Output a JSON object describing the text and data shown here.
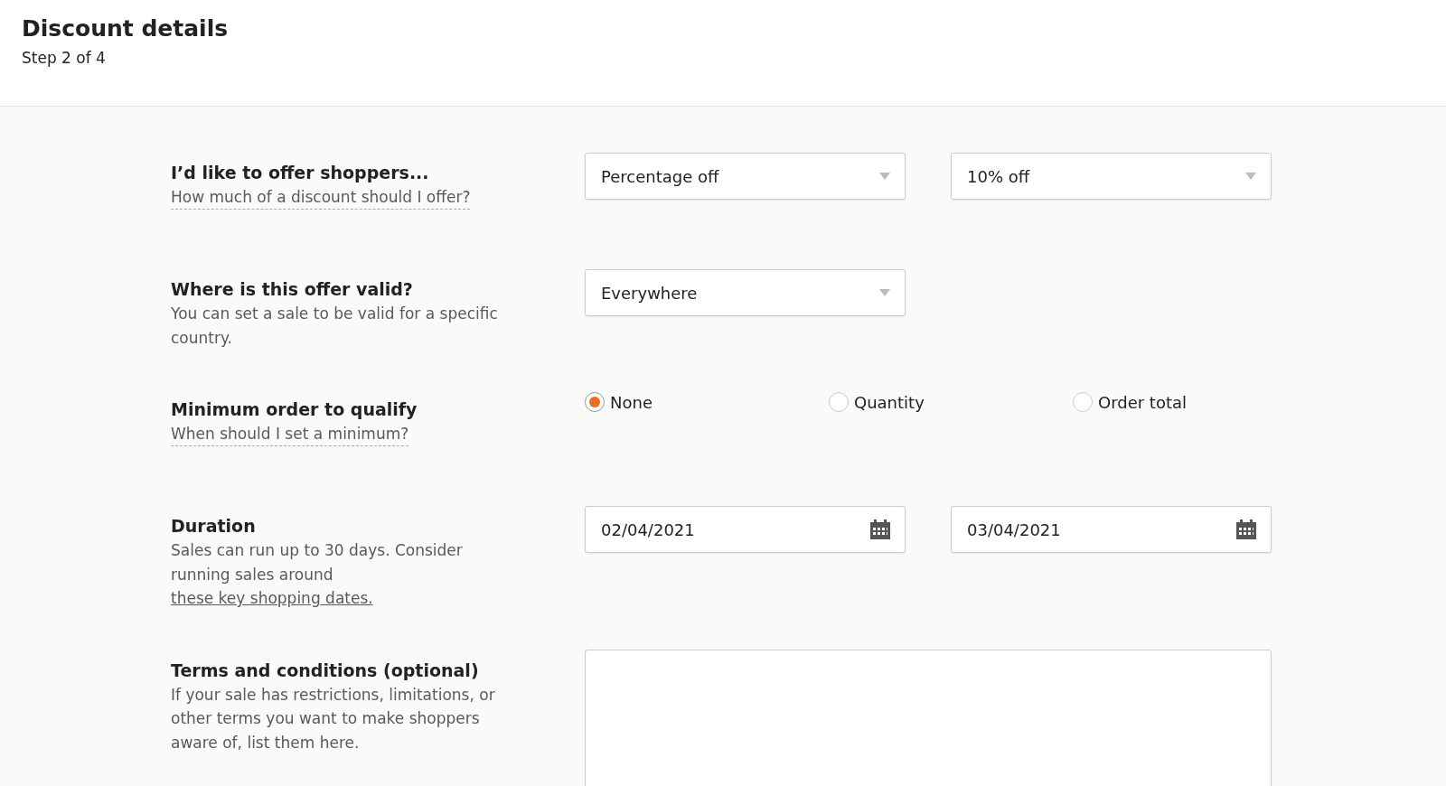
{
  "header": {
    "title": "Discount details",
    "step": "Step 2 of 4"
  },
  "rows": [
    {
      "heading": "I’d like to offer shoppers...",
      "help": {
        "kind": "tooltip",
        "text": "How much of a discount should I offer?"
      },
      "controls": [
        {
          "kind": "select",
          "value": "Percentage off"
        },
        {
          "kind": "select",
          "value": "10% off"
        }
      ]
    },
    {
      "heading": "Where is this offer valid?",
      "help": {
        "kind": "text",
        "text": "You can set a sale to be valid for a specific country."
      },
      "controls": [
        {
          "kind": "select",
          "value": "Everywhere"
        }
      ]
    },
    {
      "heading": "Minimum order to qualify",
      "help": {
        "kind": "tooltip",
        "text": "When should I set a minimum?"
      },
      "controls": [
        {
          "kind": "radio",
          "label": "None",
          "selected": true
        },
        {
          "kind": "radio",
          "label": "Quantity",
          "selected": false
        },
        {
          "kind": "radio",
          "label": "Order total",
          "selected": false
        }
      ]
    },
    {
      "heading": "Duration",
      "help": {
        "kind": "text",
        "text": "Sales can run up to 30 days. Consider running sales around",
        "link": "these key shopping dates."
      },
      "controls": [
        {
          "kind": "date",
          "value": "02/04/2021"
        },
        {
          "kind": "date",
          "value": "03/04/2021"
        }
      ]
    },
    {
      "heading": "Terms and conditions (optional)",
      "help": {
        "kind": "text",
        "text": "If your sale has restrictions, limitations, or other terms you want to make shoppers aware of, list them here."
      },
      "controls": [
        {
          "kind": "textarea"
        }
      ]
    }
  ]
}
